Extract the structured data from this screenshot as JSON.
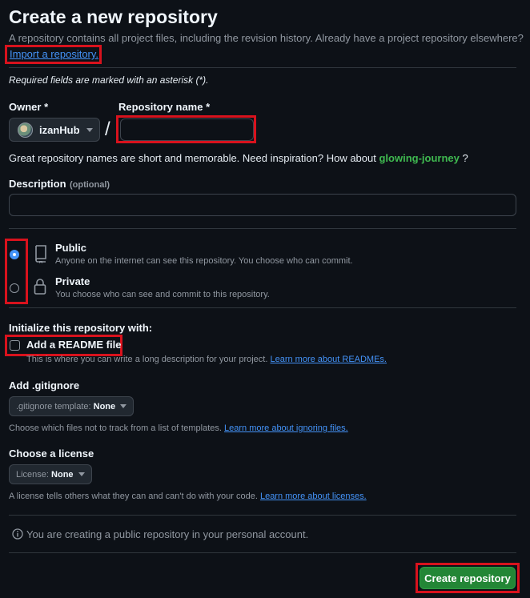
{
  "header": {
    "title": "Create a new repository",
    "subtitle": "A repository contains all project files, including the revision history. Already have a project repository elsewhere?",
    "import_link": "Import a repository."
  },
  "required_note": "Required fields are marked with an asterisk (*).",
  "owner": {
    "label": "Owner *",
    "value": "izanHub"
  },
  "separator": "/",
  "repo_name": {
    "label": "Repository name *",
    "value": "",
    "placeholder": ""
  },
  "suggestion": {
    "text": "Great repository names are short and memorable. Need inspiration? How about",
    "name": "glowing-journey",
    "end": "?"
  },
  "description": {
    "label": "Description",
    "optional": "(optional)",
    "value": "",
    "placeholder": ""
  },
  "visibility": {
    "public": {
      "title": "Public",
      "desc": "Anyone on the internet can see this repository. You choose who can commit.",
      "checked": true
    },
    "private": {
      "title": "Private",
      "desc": "You choose who can see and commit to this repository.",
      "checked": false
    }
  },
  "init": {
    "heading": "Initialize this repository with:",
    "readme_label": "Add a README file",
    "readme_checked": false,
    "readme_desc": "This is where you can write a long description for your project.",
    "readme_link": "Learn more about READMEs."
  },
  "gitignore": {
    "heading": "Add .gitignore",
    "button_prefix": ".gitignore template:",
    "button_value": "None",
    "desc": "Choose which files not to track from a list of templates.",
    "link": "Learn more about ignoring files."
  },
  "license": {
    "heading": "Choose a license",
    "button_prefix": "License:",
    "button_value": "None",
    "desc": "A license tells others what they can and can't do with your code.",
    "link": "Learn more about licenses."
  },
  "info_note": "You are creating a public repository in your personal account.",
  "submit_label": "Create repository",
  "colors": {
    "background": "#0d1117",
    "accent_link": "#4493f8",
    "suggestion_green": "#3fb950",
    "primary_button": "#238636",
    "highlight_box": "#d8121d"
  },
  "icons": {
    "public": "repo-icon",
    "private": "lock-icon",
    "info": "info-icon",
    "dropdown": "caret-down-icon"
  }
}
